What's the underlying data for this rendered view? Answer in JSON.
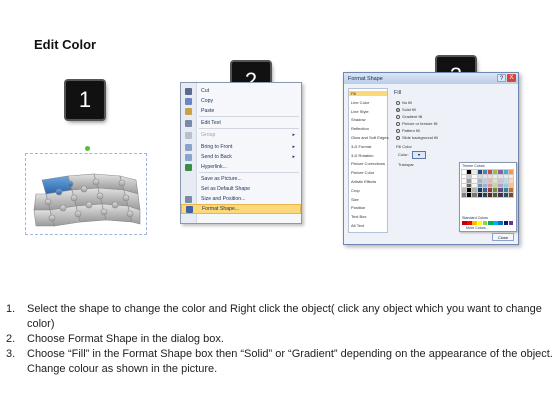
{
  "title": "Edit Color",
  "badges": [
    "1",
    "2",
    "3"
  ],
  "context_menu": {
    "items": [
      {
        "label": "Cut",
        "icon": "scissors-icon",
        "color": "#5a6c8c",
        "submenu": false,
        "disabled": false
      },
      {
        "label": "Copy",
        "icon": "copy-icon",
        "color": "#6b86c2",
        "submenu": false,
        "disabled": false
      },
      {
        "label": "Paste",
        "icon": "paste-icon",
        "color": "#c8a24a",
        "submenu": false,
        "disabled": false
      },
      {
        "label": "Edit Text",
        "icon": "edit-text-icon",
        "color": "#7c8aa6",
        "submenu": false,
        "disabled": false
      },
      {
        "label": "Group",
        "icon": "group-icon",
        "color": "#b9c0cc",
        "submenu": true,
        "disabled": true
      },
      {
        "label": "Bring to Front",
        "icon": "bring-to-front-icon",
        "color": "#8aa3cf",
        "submenu": true,
        "disabled": false
      },
      {
        "label": "Send to Back",
        "icon": "send-to-back-icon",
        "color": "#8aa3cf",
        "submenu": true,
        "disabled": false
      },
      {
        "label": "Hyperlink...",
        "icon": "hyperlink-icon",
        "color": "#3b8c4a",
        "submenu": false,
        "disabled": false
      },
      {
        "label": "Save as Picture...",
        "icon": "",
        "color": "",
        "submenu": false,
        "disabled": false
      },
      {
        "label": "Set as Default Shape",
        "icon": "",
        "color": "",
        "submenu": false,
        "disabled": false
      },
      {
        "label": "Size and Position...",
        "icon": "size-position-icon",
        "color": "#7c8aa6",
        "submenu": false,
        "disabled": false
      },
      {
        "label": "Format Shape...",
        "icon": "format-shape-icon",
        "color": "#3f63a8",
        "submenu": false,
        "disabled": false,
        "highlight": true
      }
    ]
  },
  "dialog": {
    "title": "Format Shape",
    "help": "?",
    "close": "X",
    "nav": [
      "Fill",
      "Line Color",
      "Line Style",
      "Shadow",
      "Reflection",
      "Glow and Soft Edges",
      "3-D Format",
      "3-D Rotation",
      "Picture Corrections",
      "Picture Color",
      "Artistic Effects",
      "Crop",
      "Size",
      "Position",
      "Text Box",
      "Alt Text"
    ],
    "fill_heading": "Fill",
    "options": [
      "No fill",
      "Solid fill",
      "Gradient fill",
      "Picture or texture fill",
      "Pattern fill",
      "Slide background fill"
    ],
    "fill_color_label": "Fill Color",
    "color_label": "Color:",
    "transparency_label": "Transpar",
    "palette": {
      "theme_label": "Theme Colors",
      "standard_label": "Standard Colors",
      "more_label": "More Colors...",
      "theme_row": [
        "#ffffff",
        "#000000",
        "#eeece1",
        "#1f497d",
        "#4f81bd",
        "#c0504d",
        "#9bbb59",
        "#8064a2",
        "#4bacc6",
        "#f79646"
      ],
      "standard_row": [
        "#c00000",
        "#ff0000",
        "#ffc000",
        "#ffff00",
        "#92d050",
        "#00b050",
        "#00b0f0",
        "#0070c0",
        "#002060",
        "#7030a0"
      ]
    },
    "close_button": "Close"
  },
  "instructions": [
    {
      "num": "1.",
      "text": "Select the shape to change the color and Right click the object( click any object which you want to change color)"
    },
    {
      "num": "2.",
      "text": "Choose Format Shape in the dialog box."
    },
    {
      "num": "3.",
      "text": "Choose “Fill” in the Format Shape box then “Solid” or “Gradient” depending on the appearance of the object. Change colour as shown in the picture."
    }
  ]
}
